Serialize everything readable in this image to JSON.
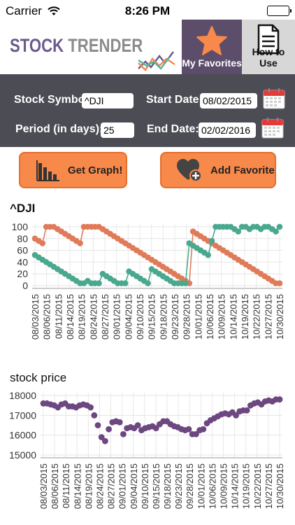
{
  "status_bar": {
    "carrier": "Carrier",
    "time": "8:26 PM"
  },
  "header": {
    "logo_word1": "STOCK",
    "logo_word2": "TRENDER",
    "favorites_tab": "My Favorites",
    "help_tab": "How to Use"
  },
  "form": {
    "symbol_label": "Stock Symbol:",
    "symbol_value": "^DJI",
    "start_label": "Start Date:",
    "start_value": "08/02/2015",
    "period_label": "Period (in days):",
    "period_value": "25",
    "end_label": "End Date:",
    "end_value": "02/02/2016"
  },
  "buttons": {
    "get_graph": "Get Graph!",
    "add_favorite": "Add Favorite"
  },
  "colors": {
    "orange_series": "#e07b5a",
    "teal_series": "#4aa88f",
    "price_series": "#6d4780",
    "button_fill": "#f7894a",
    "panel": "#4c4c55",
    "favorites_tab": "#5c4d6b"
  },
  "chart_data": [
    {
      "type": "line",
      "title": "^DJI",
      "ylim": [
        0,
        100
      ],
      "yticks": [
        0,
        20,
        40,
        60,
        80,
        100
      ],
      "grid": true,
      "xtick_labels": [
        "08/03/2015",
        "08/06/2015",
        "08/11/2015",
        "08/14/2015",
        "08/19/2015",
        "08/24/2015",
        "08/27/2015",
        "09/01/2015",
        "09/04/2015",
        "09/10/2015",
        "09/15/2015",
        "09/18/2015",
        "09/23/2015",
        "09/28/2015",
        "10/01/2015",
        "10/06/2015",
        "10/09/2015",
        "10/14/2015",
        "10/19/2015",
        "10/22/2015",
        "10/27/2015",
        "10/30/2015"
      ],
      "series": [
        {
          "values": [
            80,
            76,
            72,
            100,
            100,
            100,
            96,
            92,
            88,
            84,
            80,
            76,
            72,
            100,
            100,
            100,
            100,
            100,
            96,
            92,
            88,
            84,
            80,
            76,
            72,
            68,
            64,
            60,
            56,
            52,
            48,
            44,
            40,
            36,
            32,
            28,
            24,
            20,
            16,
            12,
            8,
            4,
            92,
            88,
            84,
            80,
            76,
            72,
            68,
            64,
            60,
            56,
            52,
            48,
            44,
            40,
            36,
            32,
            28,
            24,
            20,
            16,
            12,
            8,
            4,
            4
          ]
        },
        {
          "values": [
            52,
            48,
            44,
            40,
            36,
            32,
            28,
            24,
            20,
            16,
            12,
            8,
            4,
            4,
            8,
            4,
            4,
            4,
            20,
            16,
            12,
            8,
            4,
            4,
            4,
            24,
            20,
            16,
            12,
            8,
            4,
            28,
            24,
            20,
            16,
            12,
            8,
            4,
            4,
            4,
            4,
            72,
            68,
            64,
            60,
            56,
            52,
            76,
            100,
            100,
            100,
            100,
            100,
            96,
            92,
            100,
            100,
            96,
            100,
            100,
            96,
            100,
            100,
            96,
            92,
            100
          ]
        }
      ]
    },
    {
      "type": "scatter",
      "title": "stock price",
      "ylim": [
        15000,
        18000
      ],
      "yticks": [
        15000,
        16000,
        17000,
        18000
      ],
      "grid": true,
      "xtick_labels": [
        "08/03/2015",
        "08/06/2015",
        "08/11/2015",
        "08/14/2015",
        "08/19/2015",
        "08/24/2015",
        "08/27/2015",
        "09/01/2015",
        "09/04/2015",
        "09/10/2015",
        "09/15/2015",
        "09/18/2015",
        "09/23/2015",
        "09/28/2015",
        "10/01/2015",
        "10/06/2015",
        "10/09/2015",
        "10/14/2015",
        "10/19/2015",
        "10/22/2015",
        "10/27/2015",
        "10/30/2015"
      ],
      "series": [
        {
          "values": [
            17600,
            17600,
            17550,
            17500,
            17400,
            17550,
            17600,
            17450,
            17450,
            17400,
            17500,
            17550,
            17500,
            17400,
            17000,
            16500,
            15900,
            15700,
            16300,
            16650,
            16700,
            16650,
            16050,
            16350,
            16400,
            16350,
            16500,
            16250,
            16350,
            16400,
            16450,
            16350,
            16550,
            16700,
            16700,
            16550,
            16450,
            16400,
            16300,
            16250,
            16300,
            16050,
            16050,
            16250,
            16300,
            16600,
            16750,
            16850,
            16950,
            17050,
            17100,
            17050,
            17150,
            17000,
            17200,
            17250,
            17250,
            17500,
            17600,
            17650,
            17550,
            17700,
            17750,
            17700,
            17800,
            17800
          ]
        }
      ]
    }
  ]
}
